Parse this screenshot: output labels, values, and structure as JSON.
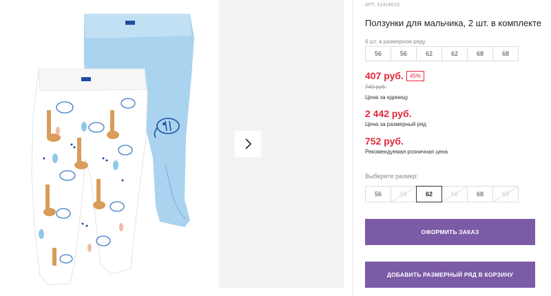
{
  "product": {
    "sku": "АРТ. 12419015",
    "title": "Ползунки для мальчика, 2 шт. в комплекте",
    "set_caption": "6 шт. в размерном ряду",
    "set_sizes": [
      "56",
      "56",
      "62",
      "62",
      "68",
      "68"
    ]
  },
  "prices": {
    "unit_price": "407 руб.",
    "discount": "45%",
    "old_price": "740 руб.",
    "unit_caption": "Цена за единицу",
    "set_price": "2 442 руб.",
    "set_caption": "Цена за размерный ряд",
    "rrp": "752 руб.",
    "rrp_caption": "Рекомендуемая розничная цена"
  },
  "size_select": {
    "caption": "Выберите размер:",
    "options": [
      {
        "label": "56",
        "state": "available"
      },
      {
        "label": "56",
        "state": "disabled"
      },
      {
        "label": "62",
        "state": "selected"
      },
      {
        "label": "56",
        "state": "disabled"
      },
      {
        "label": "68",
        "state": "available"
      },
      {
        "label": "68",
        "state": "disabled"
      }
    ]
  },
  "buttons": {
    "order": "ОФОРМИТЬ ЗАКАЗ",
    "add_set": "ДОБАВИТЬ РАЗМЕРНЫЙ РЯД В КОРЗИНУ"
  },
  "gallery": {
    "next_icon": "chevron-right-icon",
    "product_image": "baby-pants-photo"
  },
  "colors": {
    "accent_purple": "#7b5aa6",
    "price_red": "#e2273a",
    "pants_blue": "#a9d3ef"
  }
}
